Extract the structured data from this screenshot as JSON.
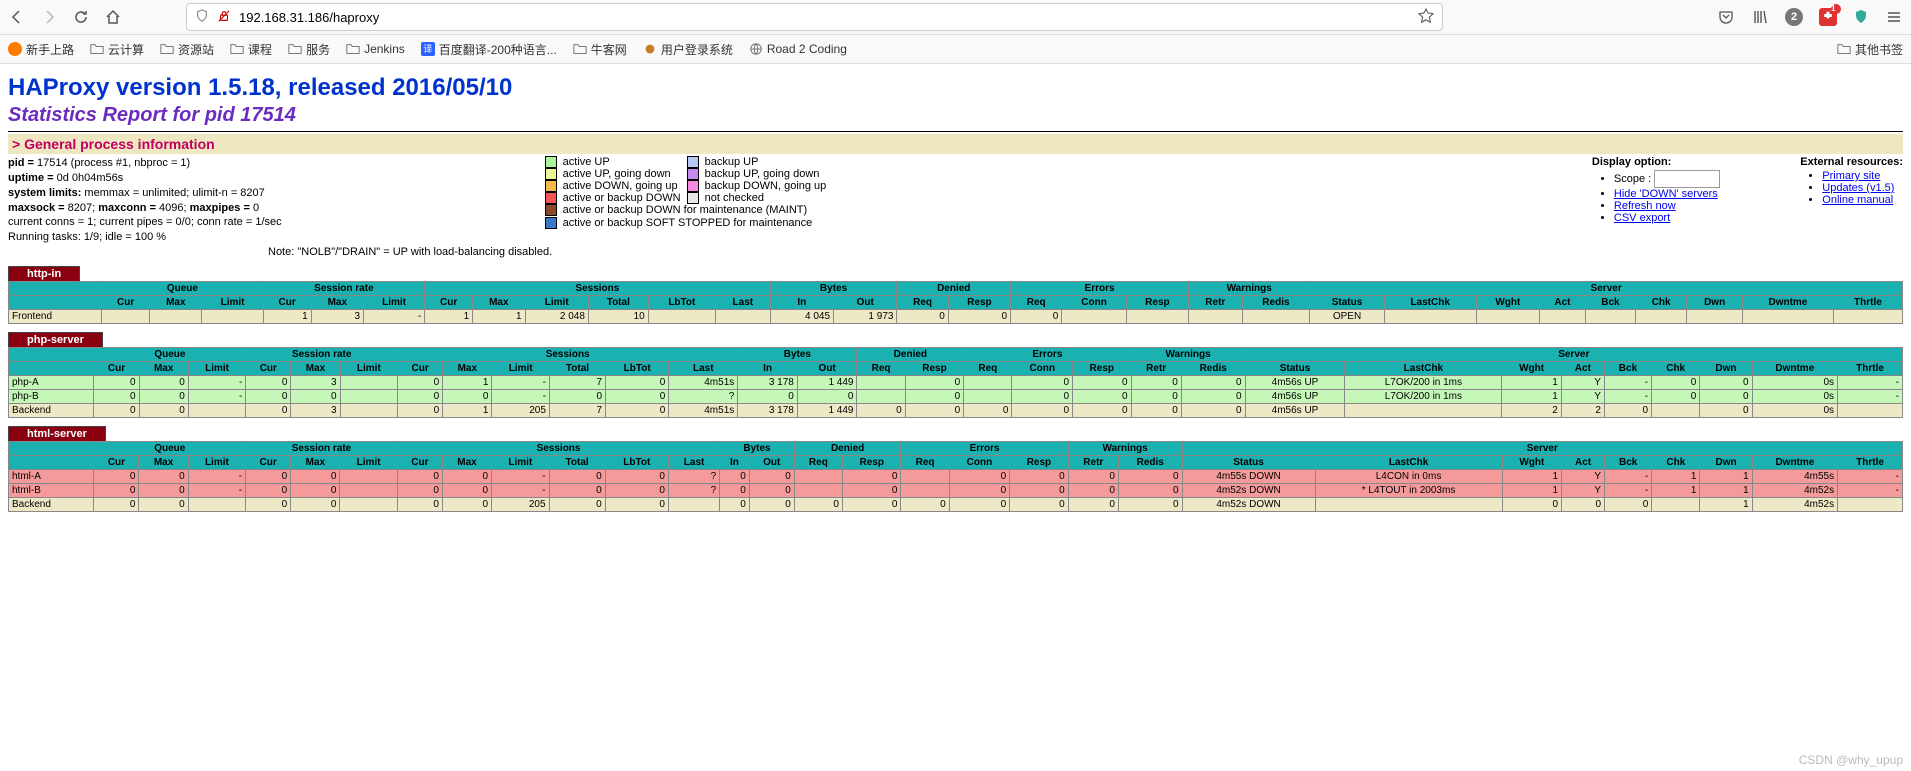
{
  "browser": {
    "url_display": "192.168.31.186/haproxy",
    "badge_count": "2",
    "notif_count": "1",
    "other_bookmarks": "其他书签"
  },
  "bookmarks": [
    "新手上路",
    "云计算",
    "资源站",
    "课程",
    "服务",
    "Jenkins",
    "百度翻译-200种语言...",
    "牛客网",
    "用户登录系统",
    "Road 2 Coding"
  ],
  "page": {
    "title": "HAProxy version 1.5.18, released 2016/05/10",
    "subtitle": "Statistics Report for pid 17514",
    "section": "> General process information"
  },
  "proc": {
    "l1a": "pid = ",
    "l1b": "17514 (process #1, nbproc = 1)",
    "l2a": "uptime = ",
    "l2b": "0d 0h04m56s",
    "l3a": "system limits:",
    "l3b": " memmax = unlimited; ulimit-n = 8207",
    "l4a": "maxsock = ",
    "l4b": "8207; ",
    "l4c": "maxconn = ",
    "l4d": "4096; ",
    "l4e": "maxpipes = ",
    "l4f": "0",
    "l5": "current conns = 1; current pipes = 0/0; conn rate = 1/sec",
    "l6": "Running tasks: 1/9; idle = 100 %"
  },
  "legend": {
    "r1a": "active UP",
    "r1b": "backup UP",
    "r2a": "active UP, going down",
    "r2b": "backup UP, going down",
    "r3a": "active DOWN, going up",
    "r3b": "backup DOWN, going up",
    "r4a": "active or backup DOWN",
    "r4b": "not checked",
    "r5": "active or backup DOWN for maintenance (MAINT)",
    "r6": "active or backup SOFT STOPPED for maintenance",
    "note": "Note: \"NOLB\"/\"DRAIN\" = UP with load-balancing disabled."
  },
  "display": {
    "header": "Display option:",
    "scope": "Scope :",
    "hide": "Hide 'DOWN' servers",
    "refresh": "Refresh now",
    "csv": "CSV export"
  },
  "ext": {
    "header": "External resources:",
    "primary": "Primary site",
    "updates": "Updates (v1.5)",
    "manual": "Online manual"
  },
  "colgroups": [
    "",
    "Queue",
    "Session rate",
    "Sessions",
    "Bytes",
    "Denied",
    "Errors",
    "Warnings",
    "Server"
  ],
  "cols": [
    "",
    "Cur",
    "Max",
    "Limit",
    "Cur",
    "Max",
    "Limit",
    "Cur",
    "Max",
    "Limit",
    "Total",
    "LbTot",
    "Last",
    "In",
    "Out",
    "Req",
    "Resp",
    "Req",
    "Conn",
    "Resp",
    "Retr",
    "Redis",
    "Status",
    "LastChk",
    "Wght",
    "Act",
    "Bck",
    "Chk",
    "Dwn",
    "Dwntme",
    "Thrtle"
  ],
  "tables": {
    "http_in": {
      "title": "http-in",
      "rows": [
        {
          "cls": "frontend",
          "c": [
            "Frontend",
            "",
            "",
            "",
            "1",
            "3",
            "-",
            "1",
            "1",
            "2 048",
            "10",
            "",
            "",
            "4 045",
            "1 973",
            "0",
            "0",
            "0",
            "",
            "",
            "",
            "",
            "OPEN",
            "",
            "",
            "",
            "",
            "",
            "",
            "",
            ""
          ]
        }
      ]
    },
    "php": {
      "title": "php-server",
      "rows": [
        {
          "cls": "up",
          "c": [
            "php-A",
            "0",
            "0",
            "-",
            "0",
            "3",
            "",
            "0",
            "1",
            "-",
            "7",
            "0",
            "4m51s",
            "3 178",
            "1 449",
            "",
            "0",
            "",
            "0",
            "0",
            "0",
            "0",
            "4m56s UP",
            "L7OK/200 in 1ms",
            "1",
            "Y",
            "-",
            "0",
            "0",
            "0s",
            "-"
          ]
        },
        {
          "cls": "up",
          "c": [
            "php-B",
            "0",
            "0",
            "-",
            "0",
            "0",
            "",
            "0",
            "0",
            "-",
            "0",
            "0",
            "?",
            "0",
            "0",
            "",
            "0",
            "",
            "0",
            "0",
            "0",
            "0",
            "4m56s UP",
            "L7OK/200 in 1ms",
            "1",
            "Y",
            "-",
            "0",
            "0",
            "0s",
            "-"
          ]
        },
        {
          "cls": "backend",
          "c": [
            "Backend",
            "0",
            "0",
            "",
            "0",
            "3",
            "",
            "0",
            "1",
            "205",
            "7",
            "0",
            "4m51s",
            "3 178",
            "1 449",
            "0",
            "0",
            "0",
            "0",
            "0",
            "0",
            "0",
            "4m56s UP",
            "",
            "2",
            "2",
            "0",
            "",
            "0",
            "0s",
            ""
          ]
        }
      ]
    },
    "html": {
      "title": "html-server",
      "rows": [
        {
          "cls": "down",
          "c": [
            "html-A",
            "0",
            "0",
            "-",
            "0",
            "0",
            "",
            "0",
            "0",
            "-",
            "0",
            "0",
            "?",
            "0",
            "0",
            "",
            "0",
            "",
            "0",
            "0",
            "0",
            "0",
            "4m55s DOWN",
            "L4CON in 0ms",
            "1",
            "Y",
            "-",
            "1",
            "1",
            "4m55s",
            "-"
          ]
        },
        {
          "cls": "down",
          "c": [
            "html-B",
            "0",
            "0",
            "-",
            "0",
            "0",
            "",
            "0",
            "0",
            "-",
            "0",
            "0",
            "?",
            "0",
            "0",
            "",
            "0",
            "",
            "0",
            "0",
            "0",
            "0",
            "4m52s DOWN",
            "* L4TOUT in 2003ms",
            "1",
            "Y",
            "-",
            "1",
            "1",
            "4m52s",
            "-"
          ]
        },
        {
          "cls": "backend",
          "c": [
            "Backend",
            "0",
            "0",
            "",
            "0",
            "0",
            "",
            "0",
            "0",
            "205",
            "0",
            "0",
            "",
            "0",
            "0",
            "0",
            "0",
            "0",
            "0",
            "0",
            "0",
            "0",
            "4m52s DOWN",
            "",
            "0",
            "0",
            "0",
            "",
            "1",
            "4m52s",
            ""
          ]
        }
      ]
    }
  },
  "watermark": "CSDN @why_upup"
}
